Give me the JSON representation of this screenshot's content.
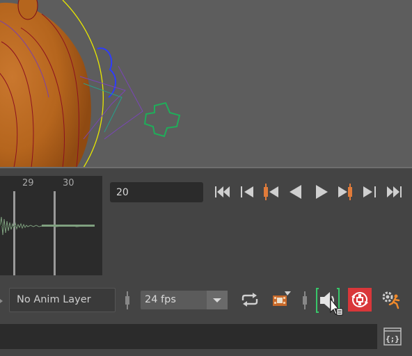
{
  "timeline": {
    "tick_labels": [
      "29",
      "30"
    ],
    "current_frame": "20"
  },
  "playback": {
    "buttons": [
      "go-to-start",
      "step-back-frame",
      "step-back-key",
      "play-backwards",
      "play-forwards",
      "step-forward-key",
      "step-forward-frame",
      "go-to-end"
    ]
  },
  "anim_layer": {
    "label": "No Anim Layer"
  },
  "fps": {
    "value": "24 fps"
  },
  "icons": [
    "loop-icon",
    "playblast-icon",
    "sound-icon",
    "auto-key-icon",
    "animation-preferences-icon",
    "script-editor-icon"
  ],
  "colors": {
    "viewport_bg": "#5d5d5d",
    "orange_mesh": "#b5651d",
    "key_orange": "#e07b3a",
    "auto_key_red": "#d9373a",
    "sound_green": "#38c76a"
  }
}
